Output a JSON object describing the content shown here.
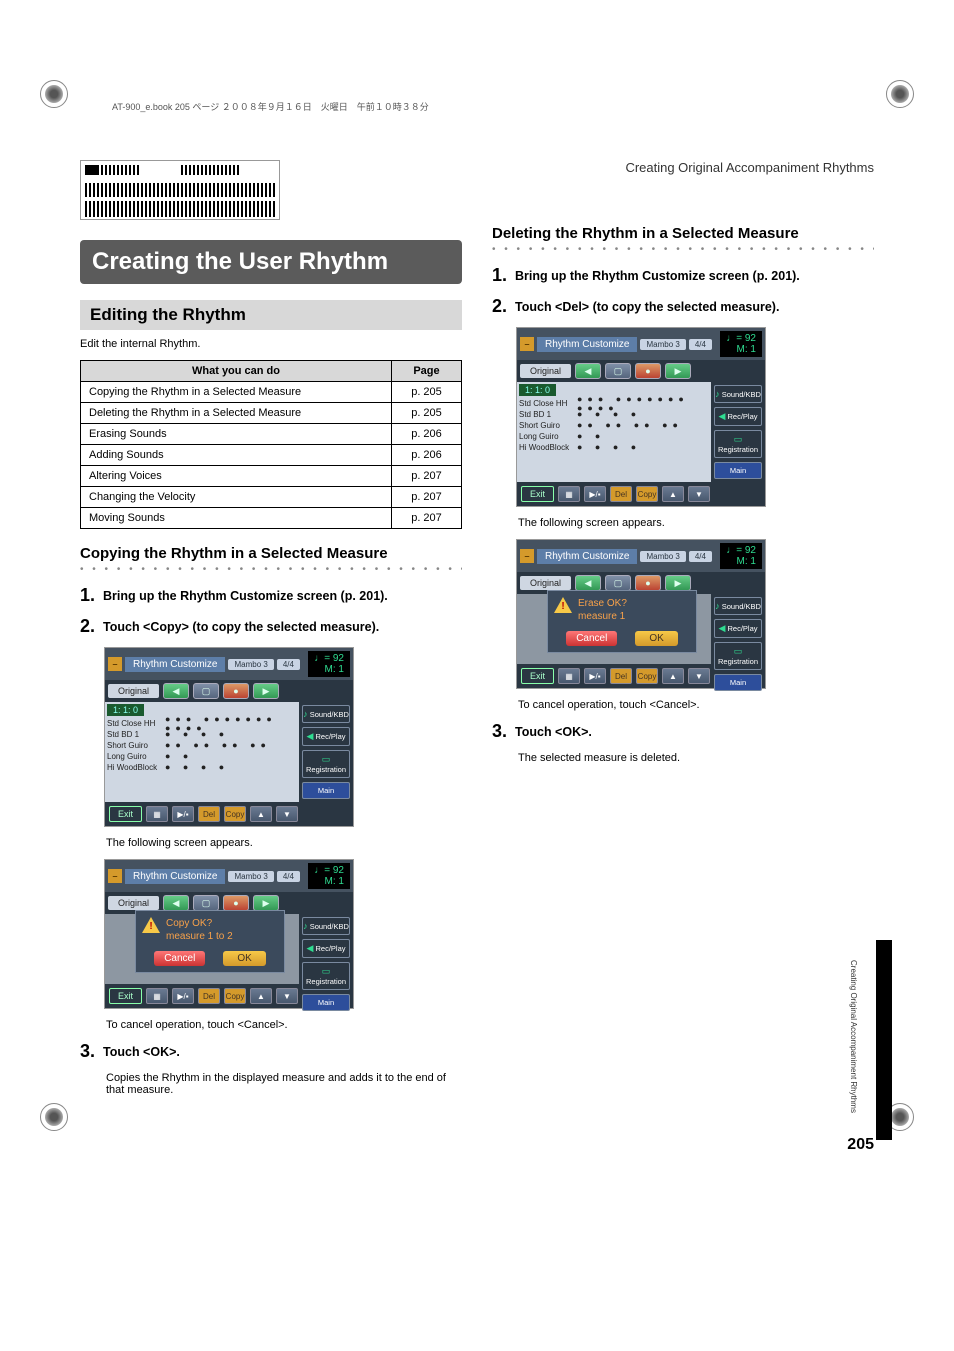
{
  "meta": {
    "header_text": "AT-900_e.book 205 ページ ２００８年９月１６日　火曜日　午前１０時３８分",
    "doc_title": "Creating Original Accompaniment Rhythms",
    "page_number": "205",
    "side_label": "Creating Original Accompaniment Rhythms"
  },
  "left": {
    "main_heading": "Creating the User Rhythm",
    "sub_heading": "Editing the Rhythm",
    "intro": "Edit the internal Rhythm.",
    "table": {
      "col1": "What you can do",
      "col2": "Page",
      "rows": [
        {
          "what": "Copying the Rhythm in a Selected Measure",
          "page": "p. 205"
        },
        {
          "what": "Deleting the Rhythm in a Selected Measure",
          "page": "p. 205"
        },
        {
          "what": "Erasing Sounds",
          "page": "p. 206"
        },
        {
          "what": "Adding Sounds",
          "page": "p. 206"
        },
        {
          "what": "Altering Voices",
          "page": "p. 207"
        },
        {
          "what": "Changing the Velocity",
          "page": "p. 207"
        },
        {
          "what": "Moving Sounds",
          "page": "p. 207"
        }
      ]
    },
    "copy_section": {
      "title": "Copying the Rhythm in a Selected Measure",
      "step1": "Bring up the Rhythm Customize screen (p. 201).",
      "step2": "Touch <Copy> (to copy the selected measure).",
      "following": "The following screen appears.",
      "dialog_line1": "Copy OK?",
      "dialog_line2": "measure 1 to 2",
      "cancel_note": "To cancel operation, touch <Cancel>.",
      "step3": "Touch <OK>.",
      "step3_note": "Copies the Rhythm in the displayed measure and adds it to the end of that measure."
    }
  },
  "right": {
    "del_section": {
      "title": "Deleting the Rhythm in a Selected Measure",
      "step1": "Bring up the Rhythm Customize screen (p. 201).",
      "step2": "Touch <Del> (to copy the selected measure).",
      "following": "The following screen appears.",
      "dialog_line1": "Erase OK?",
      "dialog_line2": "measure 1",
      "cancel_note": "To cancel operation, touch <Cancel>.",
      "step3": "Touch <OK>.",
      "step3_note": "The selected measure is deleted."
    }
  },
  "screenshot": {
    "title": "Rhythm Customize",
    "style_chip": "Mambo 3",
    "ts_chip": "4/4",
    "tempo_top": "♩= 92",
    "tempo_bot": "M: 1",
    "orig_label": "Original",
    "time": "1: 1: 0",
    "tracks": [
      {
        "name": "Std Close HH",
        "dots": "●●● ●●●●●●● ●●●●"
      },
      {
        "name": "Std BD 1",
        "dots": "  ●   ●     ●   ●"
      },
      {
        "name": "Short Guiro",
        "dots": "  ●●  ●●  ●●  ●●"
      },
      {
        "name": "Long Guiro",
        "dots": "●       ●"
      },
      {
        "name": "Hi WoodBlock",
        "dots": "   ●  ●   ●   ●"
      }
    ],
    "side": {
      "sound": "Sound/KBD",
      "rec": "Rec/Play",
      "reg": "Registration",
      "main": "Main"
    },
    "foot": {
      "exit": "Exit",
      "playstop": "▶/▪",
      "del": "Del",
      "copy": "Copy",
      "up": "▲",
      "down": "▼"
    },
    "dlg": {
      "cancel": "Cancel",
      "ok": "OK"
    }
  }
}
